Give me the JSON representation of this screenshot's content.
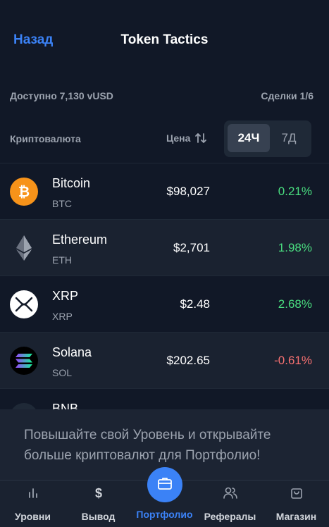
{
  "header": {
    "back_label": "Назад",
    "title": "Token Tactics"
  },
  "info": {
    "available": "Доступно 7,130 vUSD",
    "deals": "Сделки 1/6"
  },
  "columns": {
    "crypto": "Криптовалюта",
    "price": "Цена"
  },
  "period_toggle": {
    "options": [
      "24Ч",
      "7Д"
    ],
    "selected": "24Ч"
  },
  "coins": [
    {
      "name": "Bitcoin",
      "symbol": "BTC",
      "price": "$98,027",
      "change": "0.21%",
      "icon": "bitcoin-icon",
      "color": "#f7931a"
    },
    {
      "name": "Ethereum",
      "symbol": "ETH",
      "price": "$2,701",
      "change": "1.98%",
      "icon": "ethereum-icon",
      "color": "#9ca3af"
    },
    {
      "name": "XRP",
      "symbol": "XRP",
      "price": "$2.48",
      "change": "2.68%",
      "icon": "xrp-icon",
      "color": "#ffffff"
    },
    {
      "name": "Solana",
      "symbol": "SOL",
      "price": "$202.65",
      "change": "-0.61%",
      "icon": "solana-icon",
      "color": "#000000"
    },
    {
      "name": "BNB",
      "symbol": "",
      "price": "",
      "change": "",
      "icon": "bnb-icon",
      "color": "#f3ba2f"
    }
  ],
  "promo_text": "Повышайте свой Уровень и открывайте больше криптовалют для Портфолио!",
  "nav": {
    "items": [
      {
        "label": "Уровни",
        "icon": "bar-chart-icon"
      },
      {
        "label": "Вывод",
        "icon": "dollar-icon"
      },
      {
        "label": "Портфолио",
        "icon": "briefcase-icon"
      },
      {
        "label": "Рефералы",
        "icon": "users-icon"
      },
      {
        "label": "Магазин",
        "icon": "shopping-bag-icon"
      }
    ],
    "active": "Портфолио"
  },
  "colors": {
    "accent": "#3b82f6",
    "positive": "#4ade80",
    "negative": "#f87171",
    "background": "#111827"
  }
}
